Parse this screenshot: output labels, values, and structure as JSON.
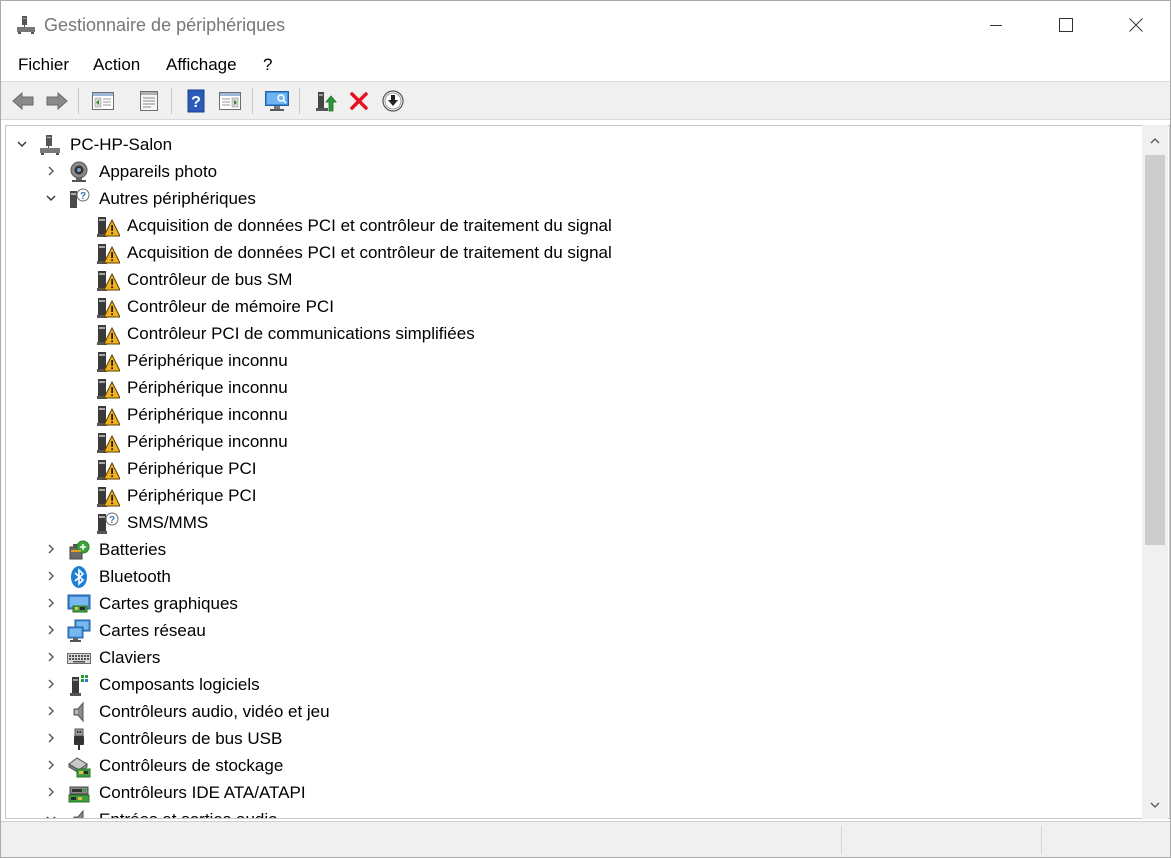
{
  "window": {
    "title": "Gestionnaire de périphériques"
  },
  "menu": {
    "items": [
      "Fichier",
      "Action",
      "Affichage",
      "?"
    ]
  },
  "toolbar": {
    "buttons": [
      "back-icon",
      "forward-icon",
      "console-tree-icon",
      "properties-icon",
      "help-icon",
      "action-pane-icon",
      "scan-monitor-icon",
      "update-driver-icon",
      "uninstall-device-icon",
      "disable-device-icon"
    ]
  },
  "colors": {
    "warning": "#f2b01e",
    "uninstall_red": "#e81123",
    "bluetooth": "#1c7fd6",
    "help_blue": "#2a5bb8",
    "scroll_thumb": "#cdcdcd"
  },
  "tree": {
    "root": {
      "label": "PC-HP-Salon",
      "expanded": true
    },
    "categories": [
      {
        "label": "Appareils photo",
        "icon": "camera-icon",
        "expanded": false
      },
      {
        "label": "Autres périphériques",
        "icon": "unknown-device-icon",
        "expanded": true
      },
      {
        "label": "Batteries",
        "icon": "battery-icon",
        "expanded": false
      },
      {
        "label": "Bluetooth",
        "icon": "bluetooth-icon",
        "expanded": false
      },
      {
        "label": "Cartes graphiques",
        "icon": "display-adapter-icon",
        "expanded": false
      },
      {
        "label": "Cartes réseau",
        "icon": "network-adapter-icon",
        "expanded": false
      },
      {
        "label": "Claviers",
        "icon": "keyboard-icon",
        "expanded": false
      },
      {
        "label": "Composants logiciels",
        "icon": "software-component-icon",
        "expanded": false
      },
      {
        "label": "Contrôleurs audio, vidéo et jeu",
        "icon": "speaker-icon",
        "expanded": false
      },
      {
        "label": "Contrôleurs de bus USB",
        "icon": "usb-icon",
        "expanded": false
      },
      {
        "label": "Contrôleurs de stockage",
        "icon": "storage-controller-icon",
        "expanded": false
      },
      {
        "label": "Contrôleurs IDE ATA/ATAPI",
        "icon": "ide-controller-icon",
        "expanded": false
      },
      {
        "label": "Entrées et sorties audio",
        "icon": "audio-io-icon",
        "expanded": true
      }
    ],
    "other_devices": [
      {
        "label": "Acquisition de données PCI et contrôleur de traitement du signal",
        "warning": true
      },
      {
        "label": "Acquisition de données PCI et contrôleur de traitement du signal",
        "warning": true
      },
      {
        "label": "Contrôleur de bus SM",
        "warning": true
      },
      {
        "label": "Contrôleur de mémoire PCI",
        "warning": true
      },
      {
        "label": "Contrôleur PCI de communications simplifiées",
        "warning": true
      },
      {
        "label": "Périphérique inconnu",
        "warning": true
      },
      {
        "label": "Périphérique inconnu",
        "warning": true
      },
      {
        "label": "Périphérique inconnu",
        "warning": true
      },
      {
        "label": "Périphérique inconnu",
        "warning": true
      },
      {
        "label": "Périphérique PCI",
        "warning": true
      },
      {
        "label": "Périphérique PCI",
        "warning": true
      },
      {
        "label": "SMS/MMS",
        "warning": false
      }
    ]
  }
}
